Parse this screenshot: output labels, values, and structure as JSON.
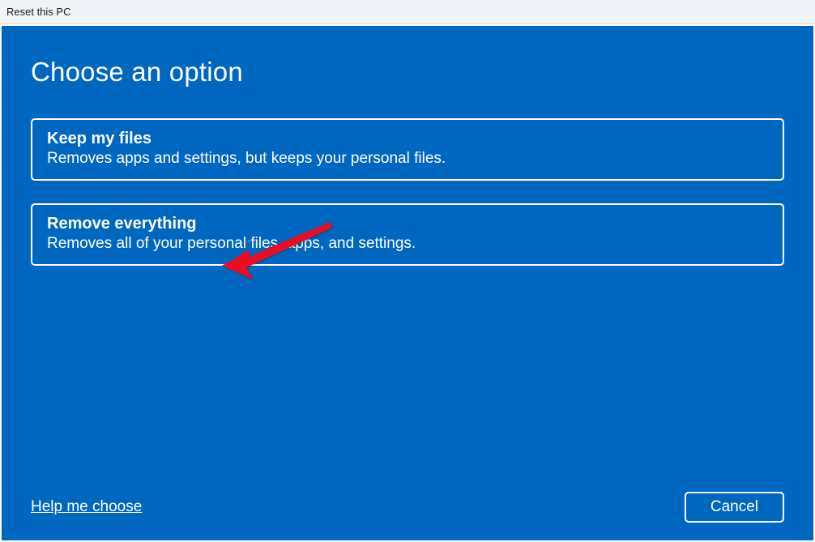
{
  "titlebar": {
    "title": "Reset this PC"
  },
  "heading": "Choose an option",
  "options": [
    {
      "title": "Keep my files",
      "description": "Removes apps and settings, but keeps your personal files."
    },
    {
      "title": "Remove everything",
      "description": "Removes all of your personal files, apps, and settings."
    }
  ],
  "footer": {
    "help_link": "Help me choose",
    "cancel_label": "Cancel"
  }
}
